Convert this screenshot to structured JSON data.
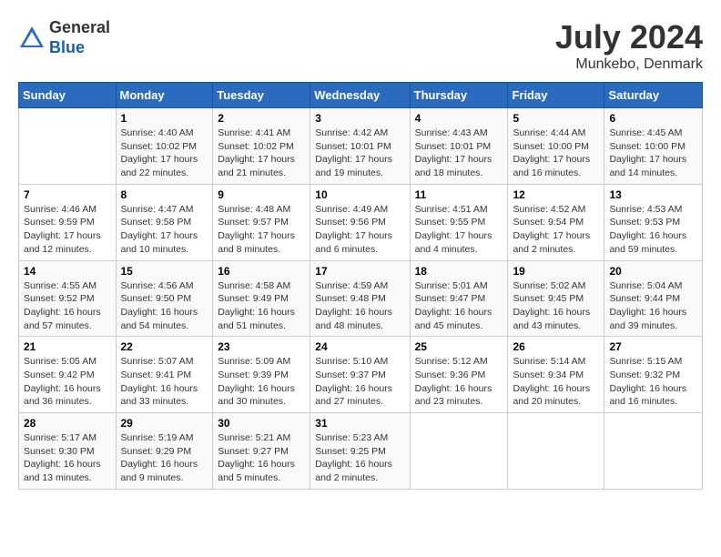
{
  "header": {
    "logo_general": "General",
    "logo_blue": "Blue",
    "month_year": "July 2024",
    "location": "Munkebo, Denmark"
  },
  "days_of_week": [
    "Sunday",
    "Monday",
    "Tuesday",
    "Wednesday",
    "Thursday",
    "Friday",
    "Saturday"
  ],
  "weeks": [
    [
      {
        "day": "",
        "sunrise": "",
        "sunset": "",
        "daylight": ""
      },
      {
        "day": "1",
        "sunrise": "Sunrise: 4:40 AM",
        "sunset": "Sunset: 10:02 PM",
        "daylight": "Daylight: 17 hours and 22 minutes."
      },
      {
        "day": "2",
        "sunrise": "Sunrise: 4:41 AM",
        "sunset": "Sunset: 10:02 PM",
        "daylight": "Daylight: 17 hours and 21 minutes."
      },
      {
        "day": "3",
        "sunrise": "Sunrise: 4:42 AM",
        "sunset": "Sunset: 10:01 PM",
        "daylight": "Daylight: 17 hours and 19 minutes."
      },
      {
        "day": "4",
        "sunrise": "Sunrise: 4:43 AM",
        "sunset": "Sunset: 10:01 PM",
        "daylight": "Daylight: 17 hours and 18 minutes."
      },
      {
        "day": "5",
        "sunrise": "Sunrise: 4:44 AM",
        "sunset": "Sunset: 10:00 PM",
        "daylight": "Daylight: 17 hours and 16 minutes."
      },
      {
        "day": "6",
        "sunrise": "Sunrise: 4:45 AM",
        "sunset": "Sunset: 10:00 PM",
        "daylight": "Daylight: 17 hours and 14 minutes."
      }
    ],
    [
      {
        "day": "7",
        "sunrise": "Sunrise: 4:46 AM",
        "sunset": "Sunset: 9:59 PM",
        "daylight": "Daylight: 17 hours and 12 minutes."
      },
      {
        "day": "8",
        "sunrise": "Sunrise: 4:47 AM",
        "sunset": "Sunset: 9:58 PM",
        "daylight": "Daylight: 17 hours and 10 minutes."
      },
      {
        "day": "9",
        "sunrise": "Sunrise: 4:48 AM",
        "sunset": "Sunset: 9:57 PM",
        "daylight": "Daylight: 17 hours and 8 minutes."
      },
      {
        "day": "10",
        "sunrise": "Sunrise: 4:49 AM",
        "sunset": "Sunset: 9:56 PM",
        "daylight": "Daylight: 17 hours and 6 minutes."
      },
      {
        "day": "11",
        "sunrise": "Sunrise: 4:51 AM",
        "sunset": "Sunset: 9:55 PM",
        "daylight": "Daylight: 17 hours and 4 minutes."
      },
      {
        "day": "12",
        "sunrise": "Sunrise: 4:52 AM",
        "sunset": "Sunset: 9:54 PM",
        "daylight": "Daylight: 17 hours and 2 minutes."
      },
      {
        "day": "13",
        "sunrise": "Sunrise: 4:53 AM",
        "sunset": "Sunset: 9:53 PM",
        "daylight": "Daylight: 16 hours and 59 minutes."
      }
    ],
    [
      {
        "day": "14",
        "sunrise": "Sunrise: 4:55 AM",
        "sunset": "Sunset: 9:52 PM",
        "daylight": "Daylight: 16 hours and 57 minutes."
      },
      {
        "day": "15",
        "sunrise": "Sunrise: 4:56 AM",
        "sunset": "Sunset: 9:50 PM",
        "daylight": "Daylight: 16 hours and 54 minutes."
      },
      {
        "day": "16",
        "sunrise": "Sunrise: 4:58 AM",
        "sunset": "Sunset: 9:49 PM",
        "daylight": "Daylight: 16 hours and 51 minutes."
      },
      {
        "day": "17",
        "sunrise": "Sunrise: 4:59 AM",
        "sunset": "Sunset: 9:48 PM",
        "daylight": "Daylight: 16 hours and 48 minutes."
      },
      {
        "day": "18",
        "sunrise": "Sunrise: 5:01 AM",
        "sunset": "Sunset: 9:47 PM",
        "daylight": "Daylight: 16 hours and 45 minutes."
      },
      {
        "day": "19",
        "sunrise": "Sunrise: 5:02 AM",
        "sunset": "Sunset: 9:45 PM",
        "daylight": "Daylight: 16 hours and 43 minutes."
      },
      {
        "day": "20",
        "sunrise": "Sunrise: 5:04 AM",
        "sunset": "Sunset: 9:44 PM",
        "daylight": "Daylight: 16 hours and 39 minutes."
      }
    ],
    [
      {
        "day": "21",
        "sunrise": "Sunrise: 5:05 AM",
        "sunset": "Sunset: 9:42 PM",
        "daylight": "Daylight: 16 hours and 36 minutes."
      },
      {
        "day": "22",
        "sunrise": "Sunrise: 5:07 AM",
        "sunset": "Sunset: 9:41 PM",
        "daylight": "Daylight: 16 hours and 33 minutes."
      },
      {
        "day": "23",
        "sunrise": "Sunrise: 5:09 AM",
        "sunset": "Sunset: 9:39 PM",
        "daylight": "Daylight: 16 hours and 30 minutes."
      },
      {
        "day": "24",
        "sunrise": "Sunrise: 5:10 AM",
        "sunset": "Sunset: 9:37 PM",
        "daylight": "Daylight: 16 hours and 27 minutes."
      },
      {
        "day": "25",
        "sunrise": "Sunrise: 5:12 AM",
        "sunset": "Sunset: 9:36 PM",
        "daylight": "Daylight: 16 hours and 23 minutes."
      },
      {
        "day": "26",
        "sunrise": "Sunrise: 5:14 AM",
        "sunset": "Sunset: 9:34 PM",
        "daylight": "Daylight: 16 hours and 20 minutes."
      },
      {
        "day": "27",
        "sunrise": "Sunrise: 5:15 AM",
        "sunset": "Sunset: 9:32 PM",
        "daylight": "Daylight: 16 hours and 16 minutes."
      }
    ],
    [
      {
        "day": "28",
        "sunrise": "Sunrise: 5:17 AM",
        "sunset": "Sunset: 9:30 PM",
        "daylight": "Daylight: 16 hours and 13 minutes."
      },
      {
        "day": "29",
        "sunrise": "Sunrise: 5:19 AM",
        "sunset": "Sunset: 9:29 PM",
        "daylight": "Daylight: 16 hours and 9 minutes."
      },
      {
        "day": "30",
        "sunrise": "Sunrise: 5:21 AM",
        "sunset": "Sunset: 9:27 PM",
        "daylight": "Daylight: 16 hours and 5 minutes."
      },
      {
        "day": "31",
        "sunrise": "Sunrise: 5:23 AM",
        "sunset": "Sunset: 9:25 PM",
        "daylight": "Daylight: 16 hours and 2 minutes."
      },
      {
        "day": "",
        "sunrise": "",
        "sunset": "",
        "daylight": ""
      },
      {
        "day": "",
        "sunrise": "",
        "sunset": "",
        "daylight": ""
      },
      {
        "day": "",
        "sunrise": "",
        "sunset": "",
        "daylight": ""
      }
    ]
  ]
}
